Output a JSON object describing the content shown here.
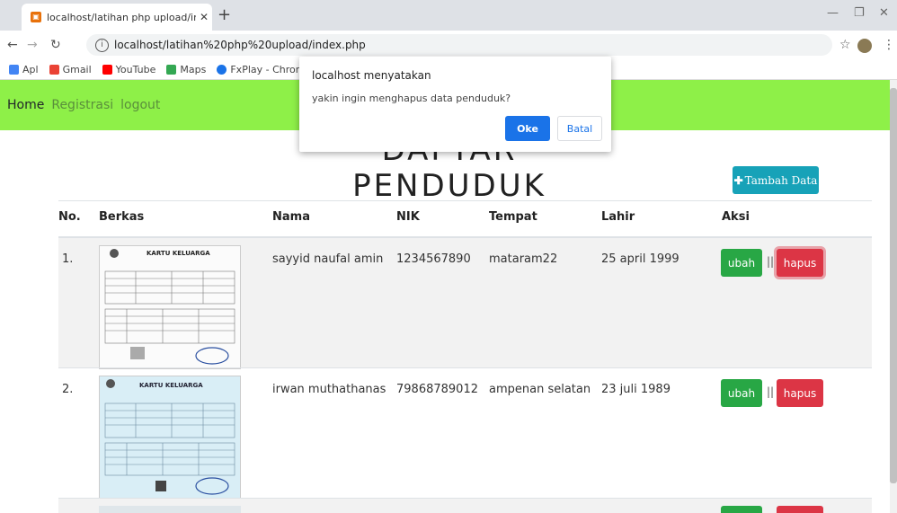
{
  "browser": {
    "tab_title": "localhost/latihan php upload/ind",
    "url": "localhost/latihan%20php%20upload/index.php",
    "bookmarks": [
      "Apl",
      "Gmail",
      "YouTube",
      "Maps",
      "FxPlay - Chrome W"
    ]
  },
  "nav": {
    "items": [
      "Home",
      "Registrasi",
      "logout"
    ],
    "colors": [
      "#212529",
      "#5a8f3c",
      "#5a8f3c"
    ],
    "bg": "#8ef048"
  },
  "page": {
    "heading": "DAFTAR PENDUDUK",
    "add_button": "Tambah Data"
  },
  "table": {
    "headers": [
      "No.",
      "Berkas",
      "Nama",
      "NIK",
      "Tempat",
      "Lahir",
      "Aksi"
    ],
    "rows": [
      {
        "no": "1.",
        "nama": "sayyid naufal amin",
        "nik": "1234567890",
        "tempat": "mataram22",
        "lahir": "25 april 1999",
        "ubah": "ubah",
        "hapus": "hapus"
      },
      {
        "no": "2.",
        "nama": "irwan muthathanas",
        "nik": "79868789012",
        "tempat": "ampenan selatan",
        "lahir": "23 juli 1989",
        "ubah": "ubah",
        "hapus": "hapus"
      }
    ],
    "thumb_title": "KARTU KELUARGA",
    "sep": "||"
  },
  "dialog": {
    "title": "localhost menyatakan",
    "message": "yakin ingin menghapus data penduduk?",
    "ok": "Oke",
    "cancel": "Batal"
  }
}
